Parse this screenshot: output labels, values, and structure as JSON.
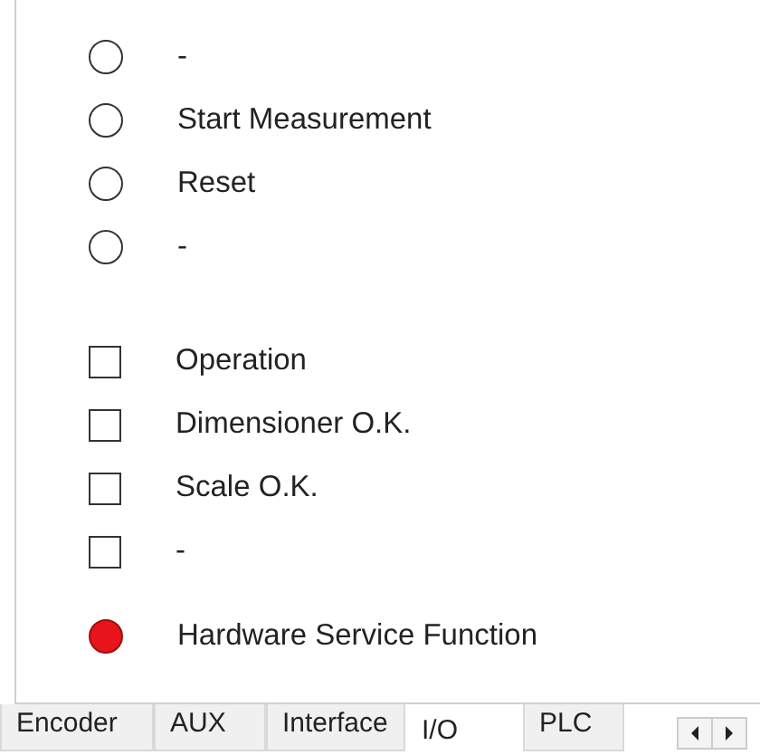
{
  "groups": [
    {
      "items": [
        {
          "kind": "led",
          "label": "-",
          "on": false
        },
        {
          "kind": "led",
          "label": "Start Measurement",
          "on": false
        },
        {
          "kind": "led",
          "label": "Reset",
          "on": false
        },
        {
          "kind": "led",
          "label": "-",
          "on": false
        }
      ]
    },
    {
      "items": [
        {
          "kind": "box",
          "label": "Operation",
          "on": false
        },
        {
          "kind": "box",
          "label": "Dimensioner O.K.",
          "on": false
        },
        {
          "kind": "box",
          "label": "Scale O.K.",
          "on": false
        },
        {
          "kind": "box",
          "label": "-",
          "on": false
        }
      ]
    },
    {
      "items": [
        {
          "kind": "led",
          "label": "Hardware Service Function",
          "on": true
        }
      ]
    }
  ],
  "tabs": [
    {
      "label": "Encoder",
      "selected": false
    },
    {
      "label": "AUX",
      "selected": false
    },
    {
      "label": "Interface",
      "selected": false
    },
    {
      "label": "I/O",
      "selected": true
    },
    {
      "label": "PLC",
      "selected": false
    }
  ]
}
